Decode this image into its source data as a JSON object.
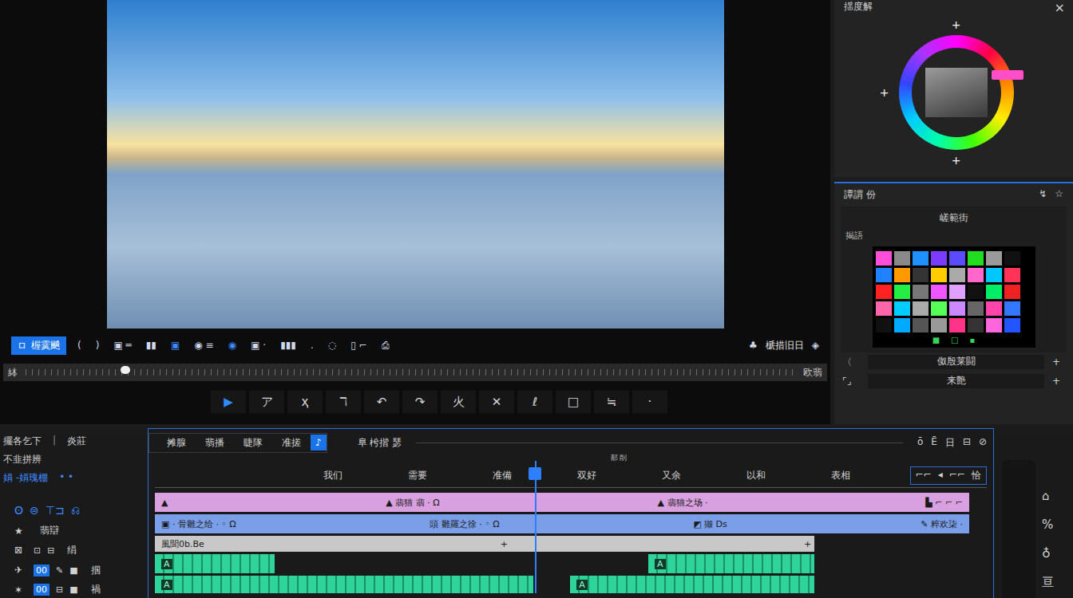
{
  "preview": {
    "kind": "photo"
  },
  "transport": {
    "mode_icon": "ロ",
    "mode_label": "楃霙飇",
    "controls": [
      "(",
      ")",
      "▣ ═",
      "▮▮",
      "▣",
      "◉ ≡",
      "◉",
      "▣ ·",
      "▮▮▮",
      ".",
      "◌",
      "▯ ⌐",
      "⎙"
    ],
    "right_icon": "♣",
    "right_label": "榹措旧日",
    "right_end": "◈"
  },
  "scrubber": {
    "left": "絊",
    "right": "欧翡",
    "level": 0.13
  },
  "tools": [
    {
      "icon": "▶",
      "selected": true
    },
    {
      "icon": "ア",
      "selected": false
    },
    {
      "icon": "ҳ",
      "selected": false
    },
    {
      "icon": "ℸ",
      "selected": false
    },
    {
      "icon": "↶",
      "selected": false
    },
    {
      "icon": "↷",
      "selected": false
    },
    {
      "icon": "火",
      "selected": false
    },
    {
      "icon": "✕",
      "selected": false
    },
    {
      "icon": "ℓ",
      "selected": false
    },
    {
      "icon": "□",
      "selected": false
    },
    {
      "icon": "≒",
      "selected": false
    },
    {
      "icon": "·",
      "selected": false
    }
  ],
  "color_panel": {
    "title": "揺度解",
    "close": "×",
    "markers": [
      "+",
      "+",
      "+"
    ]
  },
  "effects_panel": {
    "title": "譚謂 份",
    "icons": [
      "↯",
      "☆"
    ],
    "heading": "嵯範街",
    "label": "揭語",
    "swatches": [
      "#ff4fd8",
      "#8a8a8a",
      "#1e90ff",
      "#7b3cff",
      "#5a4bff",
      "#22dd22",
      "#9a9a9a",
      "#111111",
      "#2080ff",
      "#ff9900",
      "#333333",
      "#ffcc00",
      "#aaaaaa",
      "#ff66cc",
      "#00c8ff",
      "#ff3355",
      "#ff2222",
      "#22ee44",
      "#777777",
      "#ee55ff",
      "#e0a0ff",
      "#111111",
      "#00ee66",
      "#ee2222",
      "#ff66aa",
      "#00ccff",
      "#aaaaaa",
      "#55ff55",
      "#cc88ff",
      "#666666",
      "#ff44aa",
      "#3377ff",
      "#111111",
      "#00aaff",
      "#555555",
      "#999999",
      "#ff3388",
      "#333333",
      "#ff66dd",
      "#2255ff"
    ],
    "footer": [
      "■",
      "□",
      "▪"
    ],
    "rows": [
      {
        "icon": "〈",
        "label": "伮殷莱闘",
        "add": "+"
      },
      {
        "icon": "⌜⌟",
        "label": "来艶",
        "add": "+"
      }
    ]
  },
  "timeline": {
    "header": {
      "title": "擺各乞下",
      "separator": "|",
      "mode": "炎莊",
      "sub": "不韭拼辨",
      "link": "娟 -娟瑰棚",
      "dots": "•  •"
    },
    "tabs": [
      {
        "label": "摊腺",
        "selected": false
      },
      {
        "label": "翡播",
        "selected": false
      },
      {
        "label": "睫隊",
        "selected": false
      },
      {
        "label": "准搓",
        "selected": false
      },
      {
        "label": "♪",
        "selected": true
      }
    ],
    "title": "阜 枍揩 瑟",
    "time": "郬 削",
    "controls": [
      "ō",
      "Ē",
      "日",
      "⊟",
      "⊘"
    ],
    "ruler": [
      "我们",
      "需要",
      "准備",
      "双好",
      "又余",
      "以和",
      "表相"
    ],
    "zoom": [
      "⌐⌐",
      "◂",
      "⌐⌐",
      "恰"
    ],
    "playhead": 0.467,
    "tracks": [
      {
        "kind": "title",
        "color": "#d9a0e0",
        "header": {
          "kind": "tools",
          "tools": [
            "ʘ",
            "⊜",
            "⊤⊐",
            "⎌"
          ]
        },
        "clips": [
          {
            "start": 0,
            "end": 1,
            "labels": [
              "▲",
              "▲ 翡猫 翡 · Ω",
              "▲ 翡猫之场 ·",
              "▙ ⌐ ⌐ ⌐"
            ]
          }
        ]
      },
      {
        "kind": "video",
        "color": "#7a9fe8",
        "header": {
          "kind": "track",
          "icon": "★",
          "badge": "",
          "buttons": [],
          "label": "翡辯"
        },
        "clips": [
          {
            "start": 0,
            "end": 1,
            "labels": [
              "▣ · 骨雛之给 · ◦ Ω",
              "頭 雛羅之徐 · ◦ Ω",
              "◩ 撷 Ds",
              "✎ 粹欢柒 ·"
            ]
          }
        ]
      },
      {
        "kind": "plain",
        "color": "#c8c8c8",
        "header": {
          "kind": "track",
          "icon": "⊠",
          "badge": "",
          "buttons": [
            "⊡",
            "⊟"
          ],
          "label": "绢"
        },
        "clips": [
          {
            "start": 0,
            "end": 0.81,
            "labels": [
              "風聞0b.Be",
              "+",
              "+"
            ]
          }
        ]
      },
      {
        "kind": "audio",
        "color": "#2fd49a",
        "header": {
          "kind": "track",
          "icon": "✈",
          "badge": "00",
          "buttons": [
            "✎",
            "■"
          ],
          "label": "掴"
        },
        "clips": [
          {
            "start": 0,
            "end": 0.147,
            "labels": [
              "A"
            ]
          },
          {
            "start": 0.606,
            "end": 0.81,
            "labels": [
              "A"
            ]
          }
        ]
      },
      {
        "kind": "audio",
        "color": "#2fd49a",
        "header": {
          "kind": "track",
          "icon": "✶",
          "badge": "00",
          "buttons": [
            "⊟",
            "■"
          ],
          "label": "禍"
        },
        "clips": [
          {
            "start": 0,
            "end": 0.465,
            "labels": [
              "A"
            ]
          },
          {
            "start": 0.51,
            "end": 0.81,
            "labels": [
              "A"
            ]
          }
        ]
      }
    ]
  },
  "side_strip": {
    "icons": [
      "⌂",
      "%",
      "♁",
      "亘"
    ]
  }
}
